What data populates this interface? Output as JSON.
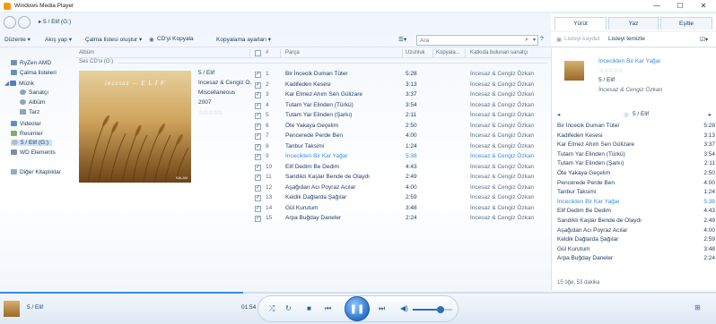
{
  "window": {
    "title": "Windows Media Player",
    "minimize": "—",
    "maximize": "☐",
    "close": "✕"
  },
  "nav": {
    "breadcrumb": "▸ 5 / Elif (G:)"
  },
  "tabs": {
    "play": "Yürüt",
    "burn": "Yaz",
    "sync": "Eşitle"
  },
  "toolbar": {
    "organize": "Düzenle ▾",
    "stream": "Akış yap ▾",
    "create_playlist": "Çalma listesi oluştur ▾",
    "rip_cd": "CD'yi Kopyala",
    "rip_settings": "Kopyalama ayarları ▾",
    "search_placeholder": "Ara"
  },
  "right_toolbar": {
    "save_list": "Listeyi kaydet",
    "clear_list": "Listeyi temizle"
  },
  "sidebar": {
    "items": [
      {
        "label": "RyZen AMD"
      },
      {
        "label": "Çalma listeleri"
      },
      {
        "label": "Müzik"
      },
      {
        "label": "Sanatçı"
      },
      {
        "label": "Albüm"
      },
      {
        "label": "Tarz"
      },
      {
        "label": "Videolar"
      },
      {
        "label": "Resimler"
      },
      {
        "label": "5 / Elif (G:)"
      },
      {
        "label": "WD Elements"
      },
      {
        "label": "Diğer Kitaplıklar"
      }
    ]
  },
  "columns": {
    "album": "Albüm",
    "number": "#",
    "title": "Parça",
    "length": "Uzunluk",
    "rip_status": "Kopyala...",
    "contributing_artist": "Katkıda bulunan sanatçı"
  },
  "group_label": "Ses CD'si (G:)",
  "album": {
    "cover_text": "incesaz — E L İ F",
    "cover_small": "KALAN",
    "name": "5 / Elif",
    "artist": "İncesaz & Cengiz Ö...",
    "genre": "Miscellaneous",
    "year": "2007",
    "rating": "☆☆☆☆☆"
  },
  "tracks": [
    {
      "n": "1",
      "title": "Bir İncecik Duman Tüter",
      "len": "5:28",
      "artist": "İncesaz & Cengiz Özkan"
    },
    {
      "n": "2",
      "title": "Kadifeden Kesesi",
      "len": "3:13",
      "artist": "İncesaz & Cengiz Özkan"
    },
    {
      "n": "3",
      "title": "Kar Elmez Ahım Sen Gülizare",
      "len": "3:37",
      "artist": "İncesaz & Cengiz Özkan"
    },
    {
      "n": "4",
      "title": "Tutam Yar Elinden (Türkü)",
      "len": "3:54",
      "artist": "İncesaz & Cengiz Özkan"
    },
    {
      "n": "5",
      "title": "Tutam Yar Elinden (Şarkı)",
      "len": "2:11",
      "artist": "İncesaz & Cengiz Özkan"
    },
    {
      "n": "6",
      "title": "Öte Yakaya Geçelim",
      "len": "2:50",
      "artist": "İncesaz & Cengiz Özkan"
    },
    {
      "n": "7",
      "title": "Pencerede Perde Ben",
      "len": "4:00",
      "artist": "İncesaz & Cengiz Özkan"
    },
    {
      "n": "8",
      "title": "Tanbur Taksimi",
      "len": "1:24",
      "artist": "İncesaz & Cengiz Özkan"
    },
    {
      "n": "9",
      "title": "İncecikten Bir Kar Yağar",
      "len": "5:38",
      "artist": "İncesaz & Cengiz Özkan"
    },
    {
      "n": "10",
      "title": "Elif Dedim Be Dedim",
      "len": "4:43",
      "artist": "İncesaz & Cengiz Özkan"
    },
    {
      "n": "11",
      "title": "Sandıklı Kaşlar Bende de Olaydı",
      "len": "2:49",
      "artist": "İncesaz & Cengiz Özkan"
    },
    {
      "n": "12",
      "title": "Aşağıdan Acı Poyraz Acılar",
      "len": "4:00",
      "artist": "İncesaz & Cengiz Özkan"
    },
    {
      "n": "13",
      "title": "Keldik Dağlarda Şağılar",
      "len": "2:59",
      "artist": "İncesaz & Cengiz Özkan"
    },
    {
      "n": "14",
      "title": "Gül Kurutum",
      "len": "3:48",
      "artist": "İncesaz & Cengiz Özkan"
    },
    {
      "n": "15",
      "title": "Arpa Buğday Daneler",
      "len": "2:24",
      "artist": "İncesaz & Cengiz Özkan"
    }
  ],
  "now_playing": {
    "title": "İncecikten Bir Kar Yağar",
    "rating": "☆☆☆☆☆",
    "album": "5 / Elif",
    "artist": "İncesaz & Cengiz Özkan"
  },
  "playlist": {
    "header": "5 / Elif",
    "items": [
      {
        "title": "Bir İncecik Duman Tüter",
        "len": "5:28"
      },
      {
        "title": "Kadifeden Kesesi",
        "len": "3:13"
      },
      {
        "title": "Kar Elmez Ahım Sen Gülizare",
        "len": "3:37"
      },
      {
        "title": "Tutam Yar Elinden (Türkü)",
        "len": "3:54"
      },
      {
        "title": "Tutam Yar Elinden (Şarkı)",
        "len": "2:11"
      },
      {
        "title": "Öte Yakaya Geçelim",
        "len": "2:50"
      },
      {
        "title": "Pencerede Perde Ben",
        "len": "4:00"
      },
      {
        "title": "Tanbur Taksimi",
        "len": "1:24"
      },
      {
        "title": "İncecikten Bir Kar Yağar",
        "len": "5:38"
      },
      {
        "title": "Elif Dedim Be Dedim",
        "len": "4:43"
      },
      {
        "title": "Sandıklı Kaşlar Bende de Olaydı",
        "len": "2:49"
      },
      {
        "title": "Aşağıdan Acı Poyraz Acılar",
        "len": "4:00"
      },
      {
        "title": "Keldik Dağlarda Şağılar",
        "len": "2:59"
      },
      {
        "title": "Gül Kurutum",
        "len": "3:48"
      },
      {
        "title": "Arpa Buğday Daneler",
        "len": "2:24"
      }
    ],
    "footer": "15 öğe, 53 dakika"
  },
  "player": {
    "title": "5 / Elif",
    "elapsed": "01:54",
    "progress": 0.34,
    "volume": 0.7
  },
  "active_track_index": 8,
  "colors": {
    "accent": "#3a8ce0",
    "text": "#1e3a5f"
  }
}
